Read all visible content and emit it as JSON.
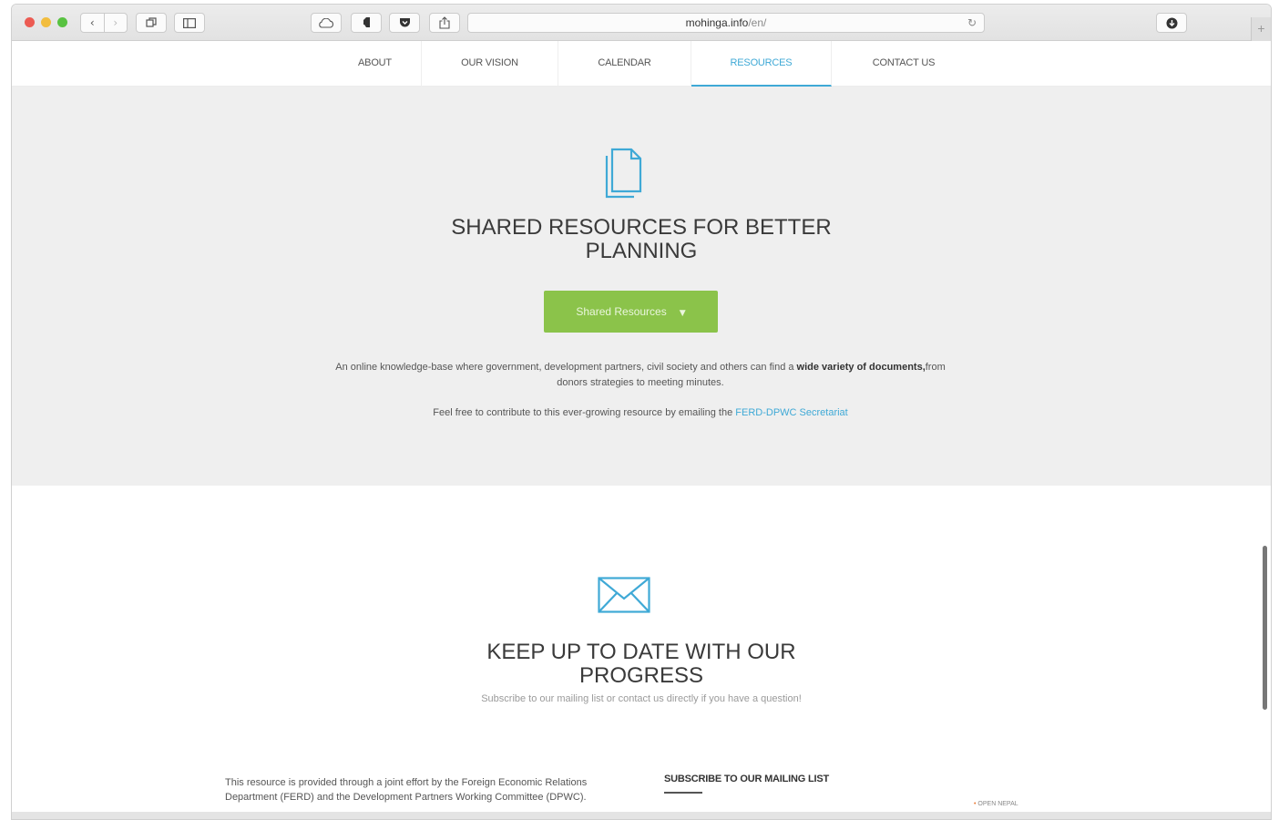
{
  "browser": {
    "url_domain": "mohinga.info",
    "url_path": "/en/",
    "buttons": {
      "back": "‹",
      "forward": "›",
      "tabs_icon": "tabs-icon",
      "sidebar_icon": "sidebar-icon",
      "cloud_icon": "cloud-icon",
      "evernote_icon": "evernote-icon",
      "pocket_icon": "pocket-icon",
      "share_icon": "share-icon",
      "reload": "↻",
      "download_icon": "download-icon",
      "new_tab": "+"
    }
  },
  "nav": {
    "items": [
      {
        "label": "ABOUT"
      },
      {
        "label": "OUR VISION"
      },
      {
        "label": "CALENDAR"
      },
      {
        "label": "RESOURCES"
      },
      {
        "label": "CONTACT US"
      }
    ],
    "active": "RESOURCES"
  },
  "resources": {
    "icon": "documents-icon",
    "title_line1": "SHARED RESOURCES FOR BETTER",
    "title_line2": "PLANNING",
    "button_label": "Shared Resources",
    "desc1_prefix": "An online knowledge-base where government, development partners, civil society and others can find a ",
    "desc1_bold": "wide variety of documents,",
    "desc1_suffix": "from donors strategies to meeting minutes.",
    "desc2_prefix": "Feel free to contribute to this ever-growing resource by emailing the ",
    "desc2_link": "FERD-DPWC Secretariat"
  },
  "progress": {
    "icon": "envelope-icon",
    "title_line1": "KEEP UP TO DATE WITH OUR",
    "title_line2": "PROGRESS",
    "subtitle": "Subscribe to our mailing list or contact us directly if you have a question!"
  },
  "footer": {
    "text": "This resource is provided through a joint effort by the Foreign Economic Relations Department (FERD) and the Development Partners Working Committee (DPWC).",
    "mailing_heading": "SUBSCRIBE TO OUR MAILING LIST",
    "logo_text": "OPEN NEPAL"
  },
  "colors": {
    "accent": "#3fa9d6",
    "button_green": "#8bc34a",
    "section_gray": "#efefef"
  }
}
